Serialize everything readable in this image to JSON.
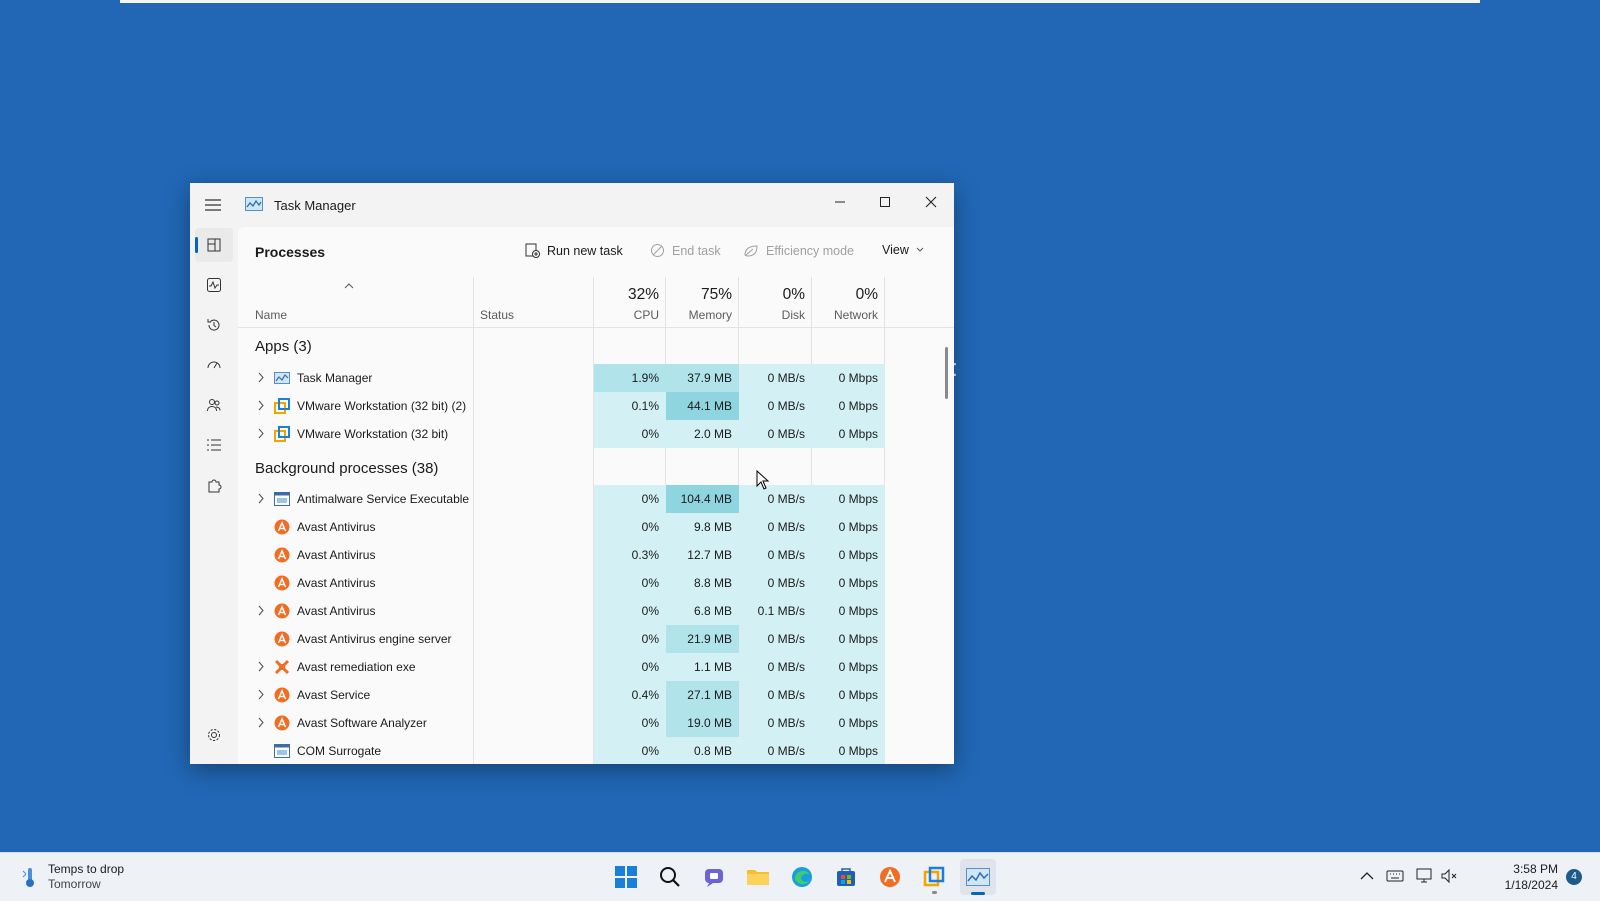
{
  "window": {
    "title": "Task Manager"
  },
  "command_bar": {
    "page_title": "Processes",
    "run_new_task": "Run new task",
    "end_task": "End task",
    "efficiency_mode": "Efficiency mode",
    "view": "View"
  },
  "columns": {
    "name": "Name",
    "status": "Status",
    "cpu": {
      "percent": "32%",
      "label": "CPU"
    },
    "memory": {
      "percent": "75%",
      "label": "Memory"
    },
    "disk": {
      "percent": "0%",
      "label": "Disk"
    },
    "network": {
      "percent": "0%",
      "label": "Network"
    }
  },
  "groups": {
    "apps": "Apps (3)",
    "background": "Background processes (38)"
  },
  "apps": [
    {
      "name": "Task Manager",
      "icon": "task-manager-icon",
      "expandable": true,
      "cpu": "1.9%",
      "memory": "37.9 MB",
      "disk": "0 MB/s",
      "network": "0 Mbps"
    },
    {
      "name": "VMware Workstation (32 bit) (2)",
      "icon": "vmware-icon",
      "expandable": true,
      "cpu": "0.1%",
      "memory": "44.1 MB",
      "disk": "0 MB/s",
      "network": "0 Mbps"
    },
    {
      "name": "VMware Workstation (32 bit)",
      "icon": "vmware-icon",
      "expandable": true,
      "cpu": "0%",
      "memory": "2.0 MB",
      "disk": "0 MB/s",
      "network": "0 Mbps"
    }
  ],
  "background": [
    {
      "name": "Antimalware Service Executable",
      "icon": "service-window-icon",
      "expandable": true,
      "cpu": "0%",
      "memory": "104.4 MB",
      "disk": "0 MB/s",
      "network": "0 Mbps"
    },
    {
      "name": "Avast Antivirus",
      "icon": "avast-icon",
      "expandable": false,
      "cpu": "0%",
      "memory": "9.8 MB",
      "disk": "0 MB/s",
      "network": "0 Mbps"
    },
    {
      "name": "Avast Antivirus",
      "icon": "avast-icon",
      "expandable": false,
      "cpu": "0.3%",
      "memory": "12.7 MB",
      "disk": "0 MB/s",
      "network": "0 Mbps"
    },
    {
      "name": "Avast Antivirus",
      "icon": "avast-icon",
      "expandable": false,
      "cpu": "0%",
      "memory": "8.8 MB",
      "disk": "0 MB/s",
      "network": "0 Mbps"
    },
    {
      "name": "Avast Antivirus",
      "icon": "avast-icon",
      "expandable": true,
      "cpu": "0%",
      "memory": "6.8 MB",
      "disk": "0.1 MB/s",
      "network": "0 Mbps"
    },
    {
      "name": "Avast Antivirus engine server",
      "icon": "avast-icon",
      "expandable": false,
      "cpu": "0%",
      "memory": "21.9 MB",
      "disk": "0 MB/s",
      "network": "0 Mbps"
    },
    {
      "name": "Avast remediation exe",
      "icon": "avast-remediation-icon",
      "expandable": true,
      "cpu": "0%",
      "memory": "1.1 MB",
      "disk": "0 MB/s",
      "network": "0 Mbps"
    },
    {
      "name": "Avast Service",
      "icon": "avast-icon",
      "expandable": true,
      "cpu": "0.4%",
      "memory": "27.1 MB",
      "disk": "0 MB/s",
      "network": "0 Mbps"
    },
    {
      "name": "Avast Software Analyzer",
      "icon": "avast-icon",
      "expandable": true,
      "cpu": "0%",
      "memory": "19.0 MB",
      "disk": "0 MB/s",
      "network": "0 Mbps"
    },
    {
      "name": "COM Surrogate",
      "icon": "service-window-icon",
      "expandable": false,
      "cpu": "0%",
      "memory": "0.8 MB",
      "disk": "0 MB/s",
      "network": "0 Mbps"
    }
  ],
  "taskbar": {
    "weather_line1": "Temps to drop",
    "weather_line2": "Tomorrow",
    "time": "3:58 PM",
    "date": "1/18/2024",
    "notification_count": "4"
  },
  "colors": {
    "desktop": "#2167b5",
    "heat_low": "#d3f0f4",
    "heat_mid": "#b0e3ea",
    "heat_high": "#8fd5df",
    "accent": "#0067c0",
    "avast": "#f26c22"
  }
}
